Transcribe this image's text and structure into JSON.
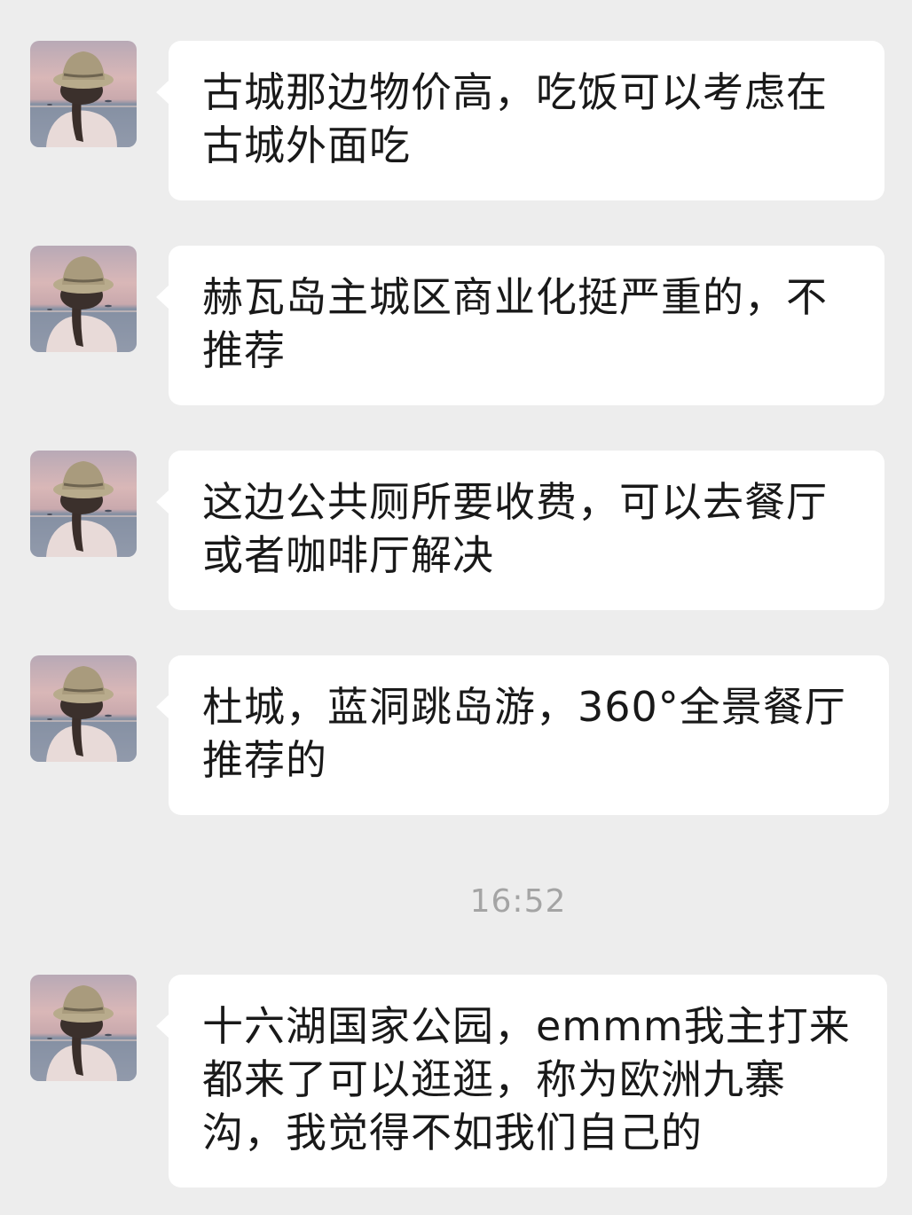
{
  "messages": [
    {
      "text": "古城那边物价高，吃饭可以考虑在古城外面吃"
    },
    {
      "text": "赫瓦岛主城区商业化挺严重的，不推荐"
    },
    {
      "text": "这边公共厕所要收费，可以去餐厅或者咖啡厅解决"
    },
    {
      "text": "杜城，蓝洞跳岛游，360°全景餐厅推荐的"
    },
    {
      "text": "十六湖国家公园，emmm我主打来都来了可以逛逛，称为欧洲九寨沟，我觉得不如我们自己的"
    }
  ],
  "timestamp": "16:52",
  "colors": {
    "background": "#ededed",
    "bubble": "#ffffff",
    "text": "#191919",
    "timestamp": "#a4a4a4"
  },
  "icons": {
    "avatar": "avatar-photo-woman-hat-sunset-sea"
  }
}
